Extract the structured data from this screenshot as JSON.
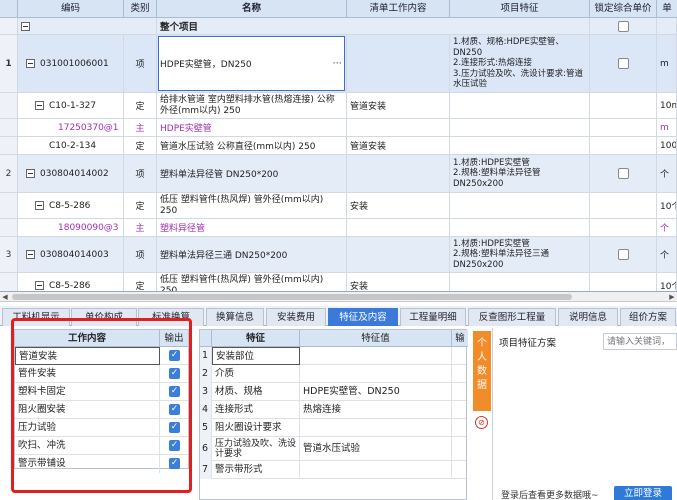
{
  "grid": {
    "headers": {
      "code": "编码",
      "category": "类别",
      "name": "名称",
      "work": "清单工作内容",
      "feature": "项目特征",
      "lock": "锁定综合单价",
      "unit": "单"
    },
    "group": {
      "label": "整个项目"
    },
    "rows": [
      {
        "no": "1",
        "code": "031001006001",
        "cat": "项",
        "name": "HDPE实壁管，DN250",
        "work": "",
        "feature": "1.材质、规格:HDPE实壁管、DN250\n2.连接形式:热熔连接\n3.压力试验及吹、洗设计要求:管道水压试验",
        "unit": "m"
      },
      {
        "no": "",
        "code": "C10-1-327",
        "cat": "定",
        "name": "给排水管道 室内塑料排水管(热熔连接) 公称外径(mm以内) 250",
        "work": "管道安装",
        "feature": "",
        "unit": "10m"
      },
      {
        "no": "",
        "code": "17250370@1",
        "cat": "主",
        "name": "HDPE实壁管",
        "work": "",
        "feature": "",
        "unit": "m"
      },
      {
        "no": "",
        "code": "C10-2-134",
        "cat": "定",
        "name": "管道水压试验 公称直径(mm以内) 250",
        "work": "管道安装",
        "feature": "",
        "unit": "100m"
      },
      {
        "no": "2",
        "code": "030804014002",
        "cat": "项",
        "name": "塑料单法异径管 DN250*200",
        "work": "",
        "feature": "1.材质:HDPE实壁管\n2.规格:塑料单法异径管DN250x200",
        "unit": "个"
      },
      {
        "no": "",
        "code": "C8-5-286",
        "cat": "定",
        "name": "低压 塑料管件(热风焊) 管外径(mm以内) 250",
        "work": "安装",
        "feature": "",
        "unit": "10个"
      },
      {
        "no": "",
        "code": "18090090@3",
        "cat": "主",
        "name": "塑料异径管",
        "work": "",
        "feature": "",
        "unit": "个"
      },
      {
        "no": "3",
        "code": "030804014003",
        "cat": "项",
        "name": "塑料单法异径三通 DN250*200",
        "work": "",
        "feature": "1.材质:HDPE实壁管\n2.规格:塑料单法异径三通DN250x200",
        "unit": "个"
      },
      {
        "no": "",
        "code": "C8-5-286",
        "cat": "定",
        "name": "低压 塑料管件(热风焊) 管外径(mm以内) 250",
        "work": "安装",
        "feature": "",
        "unit": "10个"
      }
    ]
  },
  "tabs": [
    "工料机显示",
    "单价构成",
    "标准换算",
    "换算信息",
    "安装费用",
    "特征及内容",
    "工程量明细",
    "反查图形工程量",
    "说明信息",
    "组价方案"
  ],
  "active_tab": "特征及内容",
  "work_panel": {
    "col_name": "工作内容",
    "col_output": "输出",
    "items": [
      "管道安装",
      "管件安装",
      "塑料卡固定",
      "阻火圈安装",
      "压力试验",
      "吹扫、冲洗",
      "警示带铺设"
    ]
  },
  "feature_panel": {
    "col_feature": "特征",
    "col_value": "特征值",
    "col_out": "输",
    "rows": [
      {
        "no": "1",
        "feature": "安装部位",
        "value": ""
      },
      {
        "no": "2",
        "feature": "介质",
        "value": ""
      },
      {
        "no": "3",
        "feature": "材质、规格",
        "value": "HDPE实壁管、DN250"
      },
      {
        "no": "4",
        "feature": "连接形式",
        "value": "热熔连接"
      },
      {
        "no": "5",
        "feature": "阻火圈设计要求",
        "value": ""
      },
      {
        "no": "6",
        "feature": "压力试验及吹、洗设计要求",
        "value": "管道水压试验"
      },
      {
        "no": "7",
        "feature": "警示带形式",
        "value": ""
      }
    ]
  },
  "side_panel": {
    "tab_label": "个人数据",
    "scheme_label": "项目特征方案",
    "search_placeholder": "请输入关键词，",
    "login_hint": "登录后查看更多数据哦~",
    "login_button": "立即登录"
  },
  "colors": {
    "accent": "#3b7ad8",
    "highlight": "#e02020",
    "purple": "#a030b0",
    "orange": "#f28c28"
  }
}
